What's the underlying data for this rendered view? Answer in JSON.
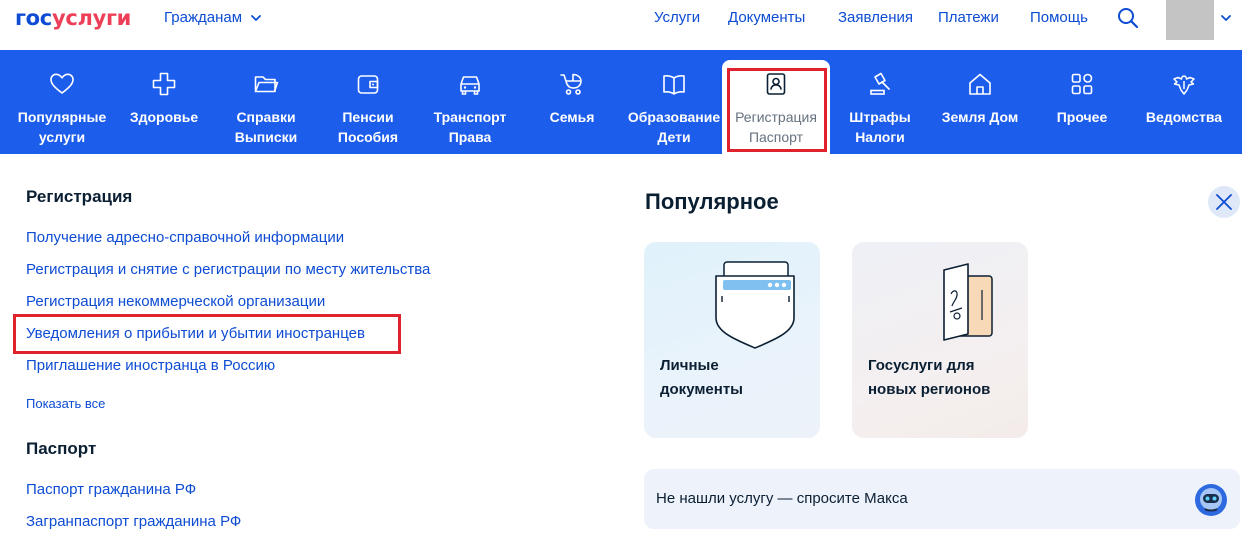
{
  "header": {
    "logo_part1": "гос",
    "logo_part2": "услуги",
    "audience": "Гражданам",
    "nav": [
      "Услуги",
      "Документы",
      "Заявления",
      "Платежи",
      "Помощь"
    ]
  },
  "categories": [
    {
      "line1": "Популярные",
      "line2": "услуги",
      "icon": "heart-icon"
    },
    {
      "line1": "Здоровье",
      "line2": "",
      "icon": "medical-cross-icon"
    },
    {
      "line1": "Справки",
      "line2": "Выписки",
      "icon": "folder-icon"
    },
    {
      "line1": "Пенсии",
      "line2": "Пособия",
      "icon": "wallet-icon"
    },
    {
      "line1": "Транспорт",
      "line2": "Права",
      "icon": "car-icon"
    },
    {
      "line1": "Семья",
      "line2": "",
      "icon": "stroller-icon"
    },
    {
      "line1": "Образование",
      "line2": "Дети",
      "icon": "book-icon"
    },
    {
      "line1": "Регистрация",
      "line2": "Паспорт",
      "icon": "id-badge-icon"
    },
    {
      "line1": "Штрафы",
      "line2": "Налоги",
      "icon": "gavel-icon"
    },
    {
      "line1": "Земля Дом",
      "line2": "",
      "icon": "house-icon"
    },
    {
      "line1": "Прочее",
      "line2": "",
      "icon": "grid-icon"
    },
    {
      "line1": "Ведомства",
      "line2": "",
      "icon": "eagle-emblem-icon"
    }
  ],
  "registration": {
    "title": "Регистрация",
    "links": [
      "Получение адресно-справочной информации",
      "Регистрация и снятие с регистрации по месту жительства",
      "Регистрация некоммерческой организации",
      "Уведомления о прибытии и убытии иностранцев",
      "Приглашение иностранца в Россию"
    ],
    "show_all": "Показать все"
  },
  "passport": {
    "title": "Паспорт",
    "links": [
      "Паспорт гражданина РФ",
      "Загранпаспорт гражданина РФ"
    ]
  },
  "popular": {
    "title": "Популярное",
    "cards": [
      {
        "line1": "Личные",
        "line2": "документы",
        "icon": "document-pocket-icon"
      },
      {
        "line1": "Госуслуги для",
        "line2": "новых регионов",
        "icon": "passport-book-icon"
      }
    ],
    "ask": "Не нашли услугу — спросите Макса"
  },
  "colors": {
    "brand_blue": "#0d4cd3",
    "brand_red": "#ee3f58",
    "category_bar": "#1d5deb",
    "highlight": "#e0212e"
  }
}
